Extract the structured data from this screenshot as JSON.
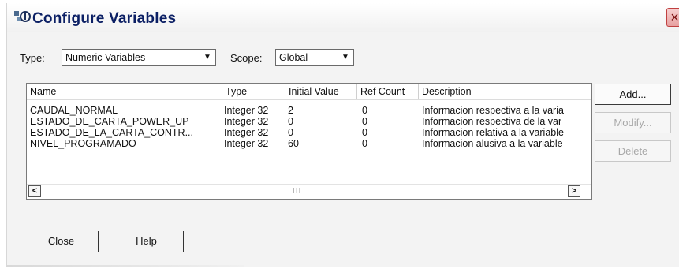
{
  "window": {
    "title": "Configure Variables",
    "close_symbol": "×"
  },
  "filters": {
    "type_label": "Type:",
    "type_value": "Numeric Variables",
    "scope_label": "Scope:",
    "scope_value": "Global"
  },
  "table": {
    "columns": [
      "Name",
      "Type",
      "Initial Value",
      "Ref Count",
      "Description"
    ],
    "rows": [
      {
        "name": "CAUDAL_NORMAL",
        "type": "Integer 32",
        "initial": "2",
        "ref": "0",
        "desc": "Informacion respectiva a la varia"
      },
      {
        "name": "ESTADO_DE_CARTA_POWER_UP",
        "type": "Integer 32",
        "initial": "0",
        "ref": "0",
        "desc": "Informacion respectiva de la var"
      },
      {
        "name": "ESTADO_DE_LA_CARTA_CONTR...",
        "type": "Integer 32",
        "initial": "0",
        "ref": "0",
        "desc": "Informacion relativa a la variable"
      },
      {
        "name": "NIVEL_PROGRAMADO",
        "type": "Integer 32",
        "initial": "60",
        "ref": "0",
        "desc": "Informacion alusiva a la variable"
      }
    ]
  },
  "scrollbar": {
    "left_arrow": "<",
    "right_arrow": ">",
    "grip": "III"
  },
  "buttons": {
    "add": "Add...",
    "modify": "Modify...",
    "delete": "Delete",
    "close": "Close",
    "help": "Help"
  }
}
